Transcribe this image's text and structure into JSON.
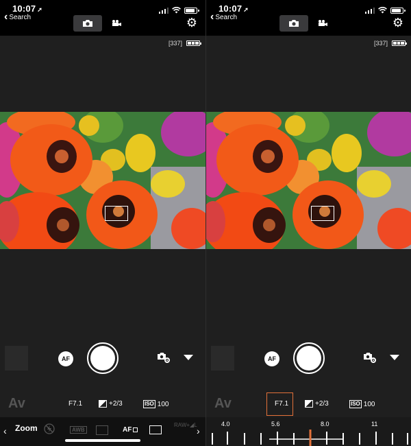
{
  "status_bar": {
    "time": "10:07",
    "location_glyph": "➚",
    "back_label": "Search"
  },
  "camera": {
    "shots_remaining": "[337]",
    "af_label": "AF"
  },
  "exposure": {
    "mode": "Av",
    "aperture": "F7.1",
    "ev": "+2/3",
    "iso_badge": "ISO",
    "iso": "100"
  },
  "bottom_bar": {
    "zoom_label": "Zoom",
    "awb_label": "AWB",
    "af_mode_label": "AF",
    "raw_label": "RAW",
    "raw_sub": "+◢L"
  },
  "aperture_dial": {
    "labels": [
      "4.0",
      "5.6",
      "8.0",
      "11"
    ],
    "accent": "#e4713a"
  },
  "colors": {
    "background": "#1f1f1f",
    "topbar": "#000000",
    "selection_outline": "#e4713a"
  },
  "icons": {
    "photo_mode": "camera-icon",
    "video_mode": "video-camera-icon",
    "settings": "gear-icon",
    "camera_settings": "camera-settings-icon",
    "flash": "flash-off-icon",
    "metering": "metering-icon",
    "aspect": "aspect-ratio-icon"
  }
}
